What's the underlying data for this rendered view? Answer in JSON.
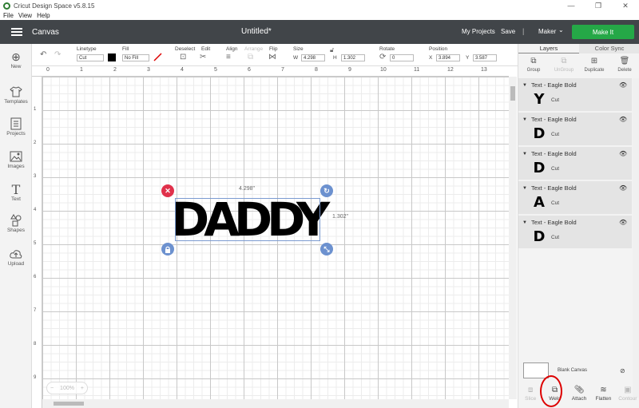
{
  "window": {
    "title": "Cricut Design Space  v5.8.15",
    "controls": [
      "—",
      "❐",
      "✕"
    ]
  },
  "menu": [
    "File",
    "View",
    "Help"
  ],
  "header": {
    "section": "Canvas",
    "doc_title": "Untitled*",
    "my_projects": "My Projects",
    "save": "Save",
    "separator": "|",
    "machine": "Maker",
    "make_it": "Make It",
    "accent": "#25a847",
    "bar_color": "#414549"
  },
  "sidebar": [
    {
      "label": "New",
      "icon": "plus-icon"
    },
    {
      "label": "Templates",
      "icon": "tshirt-icon"
    },
    {
      "label": "Projects",
      "icon": "projects-icon"
    },
    {
      "label": "Images",
      "icon": "image-icon"
    },
    {
      "label": "Text",
      "icon": "text-icon"
    },
    {
      "label": "Shapes",
      "icon": "shapes-icon"
    },
    {
      "label": "Upload",
      "icon": "upload-icon"
    }
  ],
  "toolbar": {
    "linetype_label": "Linetype",
    "linetype_value": "Cut",
    "fill_label": "Fill",
    "fill_value": "No Fill",
    "deselect": "Deselect",
    "edit": "Edit",
    "align": "Align",
    "arrange": "Arrange",
    "flip": "Flip",
    "size_label": "Size",
    "w_label": "W",
    "w_value": "4.298",
    "h_label": "H",
    "h_value": "1.302",
    "rotate_label": "Rotate",
    "rotate_value": "0",
    "position_label": "Position",
    "x_label": "X",
    "x_value": "3.894",
    "y_label": "Y",
    "y_value": "3.587"
  },
  "ruler_top": [
    "0",
    "1",
    "2",
    "3",
    "4",
    "5",
    "6",
    "7",
    "8",
    "9",
    "10",
    "11",
    "12",
    "13"
  ],
  "ruler_left": [
    "1",
    "2",
    "3",
    "4",
    "5",
    "6",
    "7",
    "8",
    "9"
  ],
  "canvas": {
    "text": "DADDY",
    "width_label": "4.298\"",
    "height_label": "1.302\"",
    "zoom": "100%",
    "zoom_minus": "−",
    "zoom_plus": "+",
    "selection_color": "#7b9bd1",
    "delete_color": "#e0314b"
  },
  "panel": {
    "tabs": [
      "Layers",
      "Color Sync"
    ],
    "actions": [
      {
        "label": "Group",
        "icon": "group-icon",
        "enabled": true
      },
      {
        "label": "UnGroup",
        "icon": "ungroup-icon",
        "enabled": false
      },
      {
        "label": "Duplicate",
        "icon": "duplicate-icon",
        "enabled": true
      },
      {
        "label": "Delete",
        "icon": "trash-icon",
        "enabled": true
      }
    ],
    "layers": [
      {
        "name": "Text - Eagle Bold",
        "glyph": "Y",
        "op": "Cut"
      },
      {
        "name": "Text - Eagle Bold",
        "glyph": "D",
        "op": "Cut"
      },
      {
        "name": "Text - Eagle Bold",
        "glyph": "D",
        "op": "Cut"
      },
      {
        "name": "Text - Eagle Bold",
        "glyph": "A",
        "op": "Cut"
      },
      {
        "name": "Text - Eagle Bold",
        "glyph": "D",
        "op": "Cut"
      }
    ],
    "blank_canvas": "Blank Canvas",
    "bottom": [
      {
        "label": "Slice",
        "icon": "slice-icon",
        "enabled": false
      },
      {
        "label": "Weld",
        "icon": "weld-icon",
        "enabled": true
      },
      {
        "label": "Attach",
        "icon": "paperclip-icon",
        "enabled": true
      },
      {
        "label": "Flatten",
        "icon": "flatten-icon",
        "enabled": true
      },
      {
        "label": "Contour",
        "icon": "contour-icon",
        "enabled": false
      }
    ]
  }
}
